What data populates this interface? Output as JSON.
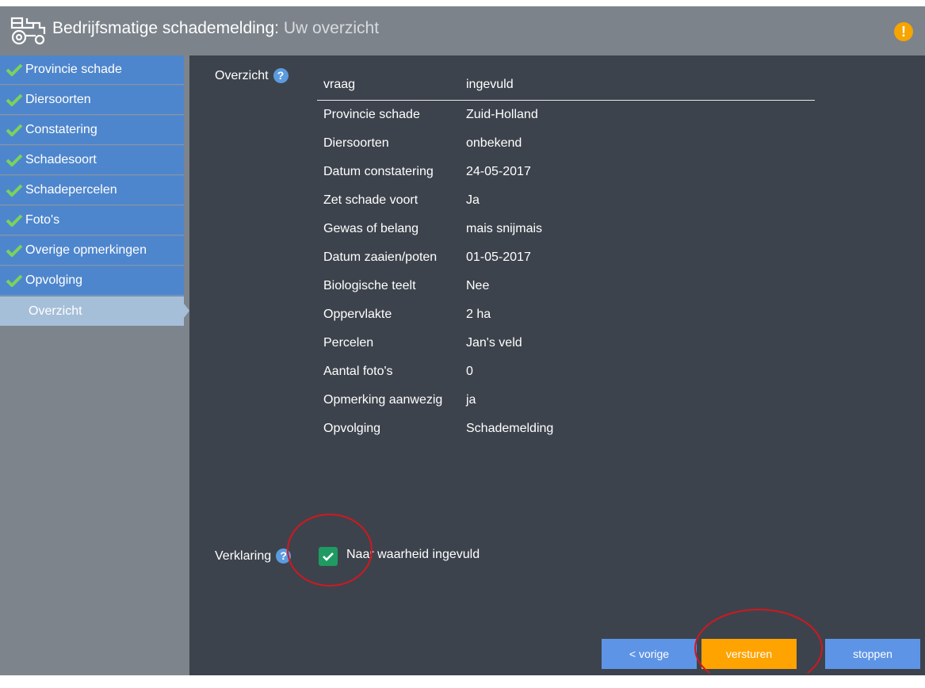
{
  "header": {
    "title": "Bedrijfsmatige schademelding:",
    "subtitle": "Uw overzicht",
    "warning_symbol": "!"
  },
  "sidebar": {
    "items": [
      {
        "label": "Provincie schade",
        "done": true
      },
      {
        "label": "Diersoorten",
        "done": true
      },
      {
        "label": "Constatering",
        "done": true
      },
      {
        "label": "Schadesoort",
        "done": true
      },
      {
        "label": "Schadepercelen",
        "done": true
      },
      {
        "label": "Foto's",
        "done": true
      },
      {
        "label": "Overige opmerkingen",
        "done": true
      },
      {
        "label": "Opvolging",
        "done": true
      },
      {
        "label": "Overzicht",
        "done": false,
        "active": true
      }
    ]
  },
  "overview": {
    "label": "Overzicht",
    "help_symbol": "?",
    "columns": [
      "vraag",
      "ingevuld"
    ],
    "rows": [
      [
        "Provincie schade",
        "Zuid-Holland"
      ],
      [
        "Diersoorten",
        "onbekend"
      ],
      [
        "Datum constatering",
        "24-05-2017"
      ],
      [
        "Zet schade voort",
        "Ja"
      ],
      [
        "Gewas of belang",
        "mais snijmais"
      ],
      [
        "Datum zaaien/poten",
        "01-05-2017"
      ],
      [
        "Biologische teelt",
        "Nee"
      ],
      [
        "Oppervlakte",
        "2 ha"
      ],
      [
        "Percelen",
        "Jan's veld"
      ],
      [
        "Aantal foto's",
        "0"
      ],
      [
        "Opmerking aanwezig",
        "ja"
      ],
      [
        "Opvolging",
        "Schademelding"
      ]
    ]
  },
  "declaration": {
    "label": "Verklaring",
    "help_symbol": "?",
    "checkbox_label": "Naar waarheid ingevuld",
    "checked": true
  },
  "buttons": {
    "prev": "< vorige",
    "send": "versturen",
    "stop": "stoppen"
  },
  "colors": {
    "header_bg": "#7c838b",
    "content_bg": "#3d434c",
    "nav_item": "#4e86cd",
    "nav_active": "#a5bfd9",
    "check_green": "#1f9a62",
    "send_button": "#ffa300",
    "nav_button": "#5e94e6",
    "warning": "#f6a400",
    "annotation": "#d3171f"
  }
}
